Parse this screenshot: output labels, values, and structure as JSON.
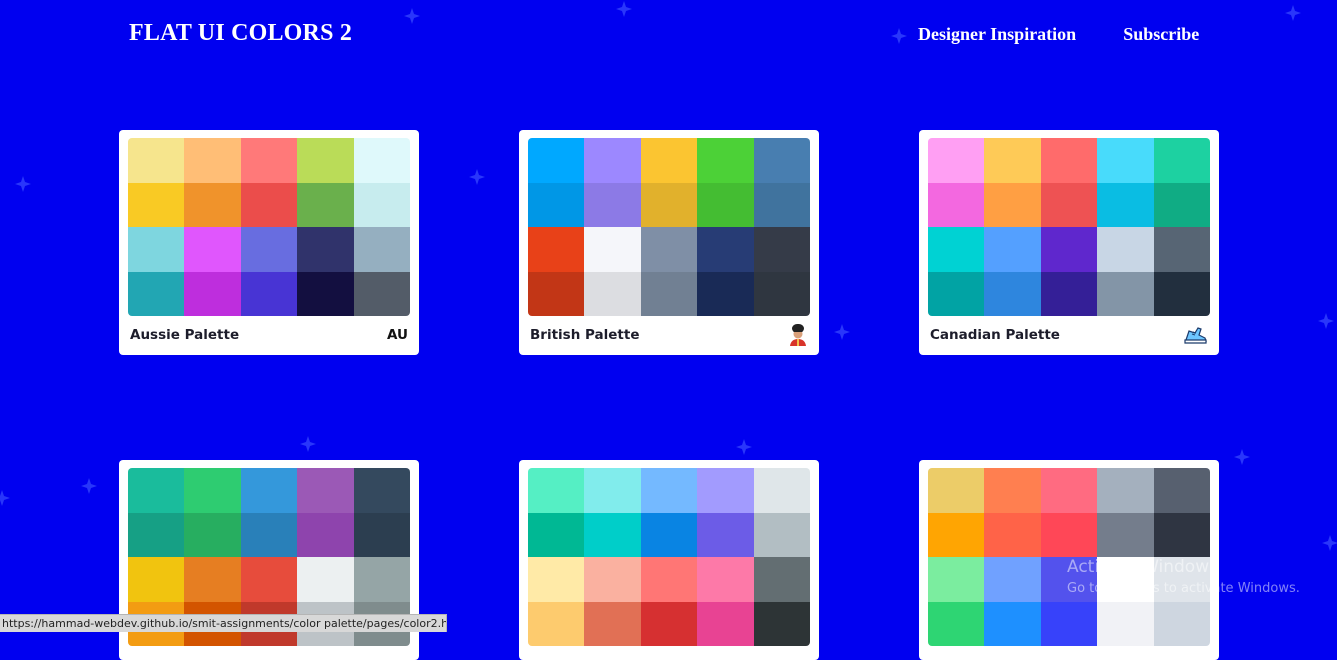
{
  "header": {
    "brand": "FLAT UI COLORS 2",
    "nav": [
      "Designer Inspiration",
      "Subscribe"
    ]
  },
  "background_color": "#0000f0",
  "palettes": [
    {
      "name": "Aussie Palette",
      "badge": "AU",
      "colors": [
        "#f6e58d",
        "#ffbe76",
        "#ff7979",
        "#badc58",
        "#dff9fb",
        "#f9ca24",
        "#f0932b",
        "#eb4d4b",
        "#6ab04c",
        "#c7ecee",
        "#7ed6df",
        "#e056fd",
        "#686de0",
        "#30336b",
        "#95afc0",
        "#22a6b3",
        "#be2edd",
        "#4834d4",
        "#130f40",
        "#535c68"
      ]
    },
    {
      "name": "British Palette",
      "badge_icon": "guard-emoji-icon",
      "colors": [
        "#00a8ff",
        "#9c88ff",
        "#fbc531",
        "#4cd137",
        "#487eb0",
        "#0097e6",
        "#8c7ae6",
        "#e1b12c",
        "#44bd32",
        "#40739e",
        "#e84118",
        "#f5f6fa",
        "#7f8fa6",
        "#273c75",
        "#353b48",
        "#c23616",
        "#dcdde1",
        "#718093",
        "#192a56",
        "#2f3640"
      ]
    },
    {
      "name": "Canadian Palette",
      "badge_icon": "sneaker-icon",
      "colors": [
        "#ff9ff3",
        "#feca57",
        "#ff6b6b",
        "#48dbfb",
        "#1dd1a1",
        "#f368e0",
        "#ff9f43",
        "#ee5253",
        "#0abde3",
        "#10ac84",
        "#00d2d3",
        "#54a0ff",
        "#5f27cd",
        "#c8d6e5",
        "#576574",
        "#01a3a4",
        "#2e86de",
        "#341f97",
        "#8395a7",
        "#222f3e"
      ]
    },
    {
      "colors": [
        "#1abc9c",
        "#2ecc71",
        "#3498db",
        "#9b59b6",
        "#34495e",
        "#16a085",
        "#27ae60",
        "#2980b9",
        "#8e44ad",
        "#2c3e50",
        "#f1c40f",
        "#e67e22",
        "#e74c3c",
        "#ecf0f1",
        "#95a5a6",
        "#f39c12",
        "#d35400",
        "#c0392b",
        "#bdc3c7",
        "#7f8c8d"
      ]
    },
    {
      "colors": [
        "#55efc4",
        "#81ecec",
        "#74b9ff",
        "#a29bfe",
        "#dfe6e9",
        "#00b894",
        "#00cec9",
        "#0984e3",
        "#6c5ce7",
        "#b2bec3",
        "#ffeaa7",
        "#fab1a0",
        "#ff7675",
        "#fd79a8",
        "#636e72",
        "#fdcb6e",
        "#e17055",
        "#d63031",
        "#e84393",
        "#2d3436"
      ]
    },
    {
      "colors": [
        "#eccc68",
        "#ff7f50",
        "#ff6b81",
        "#a4b0be",
        "#57606f",
        "#ffa502",
        "#ff6348",
        "#ff4757",
        "#747d8c",
        "#2f3542",
        "#7bed9f",
        "#70a1ff",
        "#5352ed",
        "#ffffff",
        "#dfe4ea",
        "#2ed573",
        "#1e90ff",
        "#3742fa",
        "#f1f2f6",
        "#ced6e0"
      ]
    }
  ],
  "status_bar": {
    "url": "https://hammad-webdev.github.io/smit-assignments/color palette/pages/color2.h..."
  },
  "watermark": {
    "title": "Activate Windows",
    "subtitle": "Go to Settings to activate Windows."
  }
}
